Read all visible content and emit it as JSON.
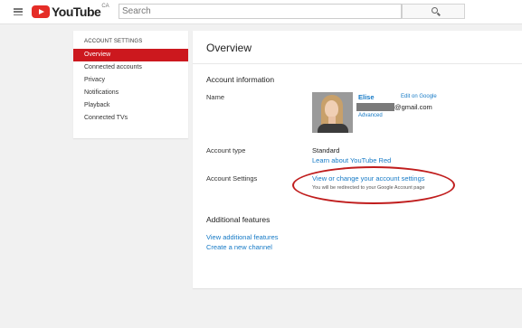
{
  "masthead": {
    "logo_text": "YouTube",
    "logo_region": "CA",
    "search_placeholder": "Search",
    "icons": {
      "menu": "hamburger-menu-icon",
      "search": "search-icon"
    }
  },
  "sidebar": {
    "heading": "ACCOUNT SETTINGS",
    "items": [
      {
        "label": "Overview",
        "active": true
      },
      {
        "label": "Connected accounts",
        "active": false
      },
      {
        "label": "Privacy",
        "active": false
      },
      {
        "label": "Notifications",
        "active": false
      },
      {
        "label": "Playback",
        "active": false
      },
      {
        "label": "Connected TVs",
        "active": false
      }
    ]
  },
  "main": {
    "title": "Overview",
    "account_info_heading": "Account information",
    "name_label": "Name",
    "user_name": "Elise",
    "edit_link": "Edit on Google",
    "email_suffix": "@gmail.com",
    "advanced_link": "Advanced",
    "account_type_label": "Account type",
    "account_type_value": "Standard",
    "learn_link": "Learn about YouTube Red",
    "account_settings_label": "Account Settings",
    "change_settings_link": "View or change your account settings",
    "redirect_note": "You will be redirected to your Google Account page",
    "additional_heading": "Additional features",
    "view_additional_link": "View additional features",
    "create_channel_link": "Create a new channel"
  },
  "colors": {
    "brand_red": "#e52d27",
    "active_nav": "#cc181e",
    "link_blue": "#167ac6",
    "annotation_red": "#c01d1d"
  }
}
